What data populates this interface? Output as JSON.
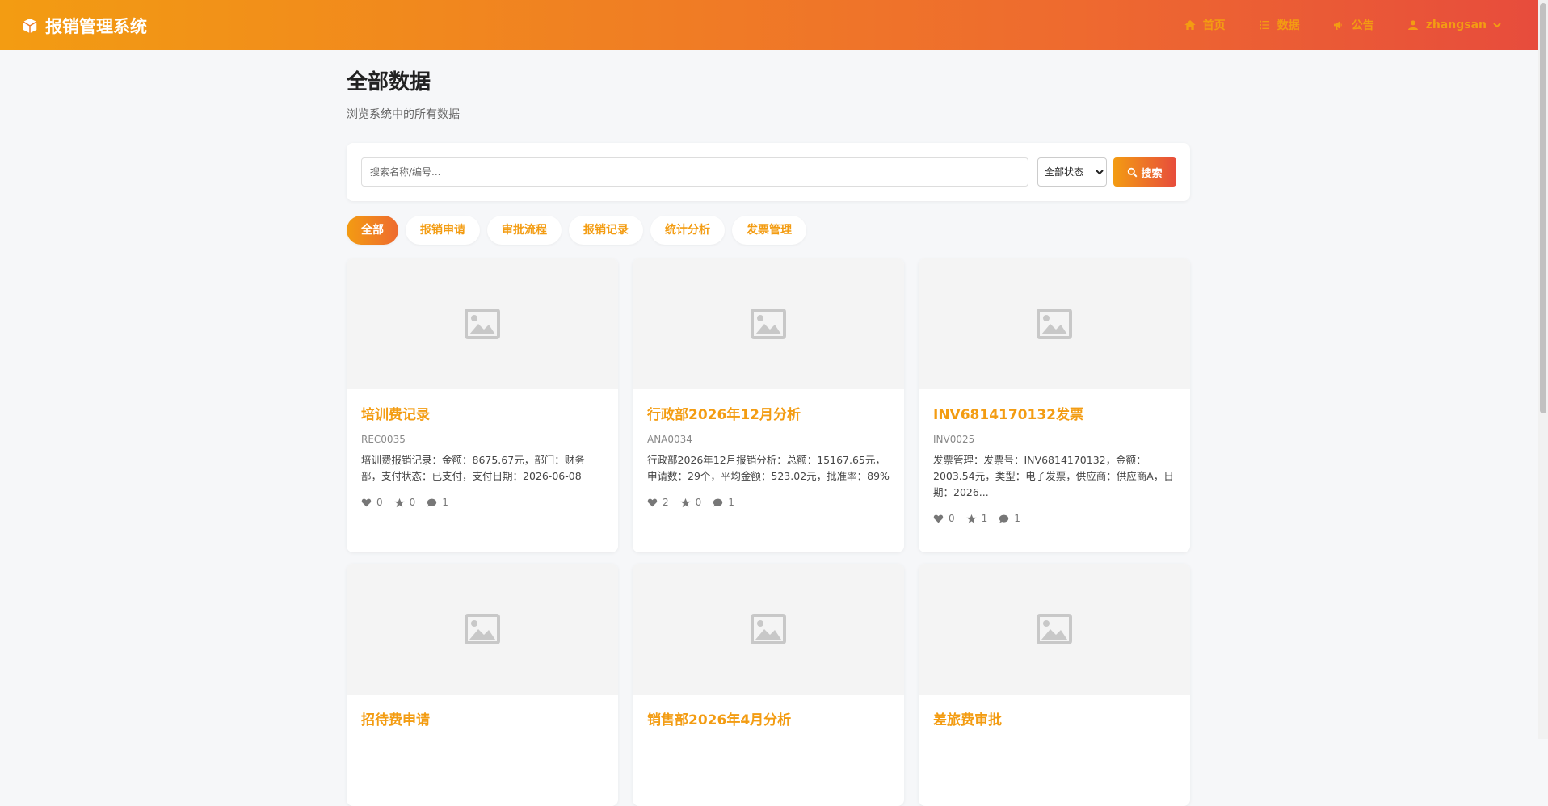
{
  "app": {
    "title": "报销管理系统"
  },
  "nav": {
    "home": "首页",
    "data": "数据",
    "notice": "公告",
    "user": "zhangsan"
  },
  "page": {
    "title": "全部数据",
    "subtitle": "浏览系统中的所有数据"
  },
  "search": {
    "placeholder": "搜索名称/编号...",
    "status_selected": "全部状态",
    "button": "搜索"
  },
  "tabs": [
    {
      "label": "全部",
      "active": true
    },
    {
      "label": "报销申请",
      "active": false
    },
    {
      "label": "审批流程",
      "active": false
    },
    {
      "label": "报销记录",
      "active": false
    },
    {
      "label": "统计分析",
      "active": false
    },
    {
      "label": "发票管理",
      "active": false
    }
  ],
  "cards": [
    {
      "title": "培训费记录",
      "code": "REC0035",
      "desc": "培训费报销记录：金额：8675.67元，部门：财务部，支付状态：已支付，支付日期：2026-06-08",
      "likes": "0",
      "favorites": "0",
      "comments": "1"
    },
    {
      "title": "行政部2026年12月分析",
      "code": "ANA0034",
      "desc": "行政部2026年12月报销分析：总额：15167.65元，申请数：29个，平均金额：523.02元，批准率：89%",
      "likes": "2",
      "favorites": "0",
      "comments": "1"
    },
    {
      "title": "INV6814170132发票",
      "code": "INV0025",
      "desc": "发票管理：发票号：INV6814170132，金额：2003.54元，类型：电子发票，供应商：供应商A，日期：2026...",
      "likes": "0",
      "favorites": "1",
      "comments": "1"
    },
    {
      "title": "招待费申请"
    },
    {
      "title": "销售部2026年4月分析"
    },
    {
      "title": "差旅费审批"
    }
  ],
  "colors": {
    "accent": "#f39c12",
    "accent_end": "#e74c3c"
  },
  "icons": {
    "brand": "cube-icon",
    "home": "home-icon",
    "data": "list-icon",
    "notice": "bullhorn-icon",
    "user": "user-icon",
    "placeholder": "image-icon"
  }
}
